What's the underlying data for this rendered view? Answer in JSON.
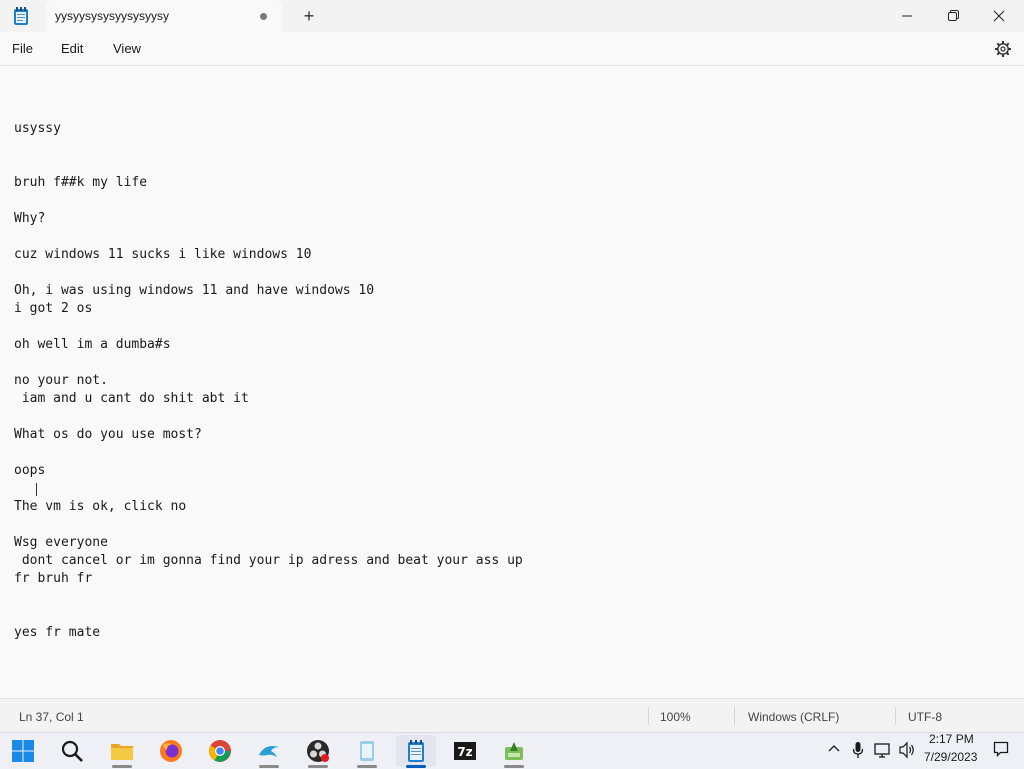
{
  "window": {
    "tab_title": "yysyysysysyysysyysy",
    "new_tab_glyph": "+"
  },
  "menu": {
    "file": "File",
    "edit": "Edit",
    "view": "View"
  },
  "editor": {
    "lines": [
      "usyssy",
      "bruh f##k my life",
      "Why?",
      "cuz windows 11 sucks i like windows 10",
      "Oh, i was using windows 11 and have windows 10",
      "i got 2 os",
      "oh well im a dumba#s",
      "no your not.",
      " iam and u cant do shit abt it",
      "What os do you use most?",
      "oops",
      "The vm is ok, click no",
      "Wsg everyone",
      " dont cancel or im gonna find your ip adress and beat your ass up",
      "fr bruh fr",
      "yes fr mate"
    ]
  },
  "status": {
    "position": "Ln 37, Col 1",
    "zoom": "100%",
    "line_ending": "Windows (CRLF)",
    "encoding": "UTF-8"
  },
  "taskbar": {
    "apps": [
      "start-icon",
      "search-icon",
      "file-explorer-icon",
      "firefox-icon",
      "chrome-icon",
      "dolphin-icon",
      "obs-icon",
      "notepad-alt-icon",
      "notepad-icon",
      "7zip-icon",
      "app-green-icon"
    ],
    "time": "2:17 PM",
    "date": "7/29/2023"
  },
  "colors": {
    "accent": "#005fb8",
    "background": "#f9f9f9"
  }
}
